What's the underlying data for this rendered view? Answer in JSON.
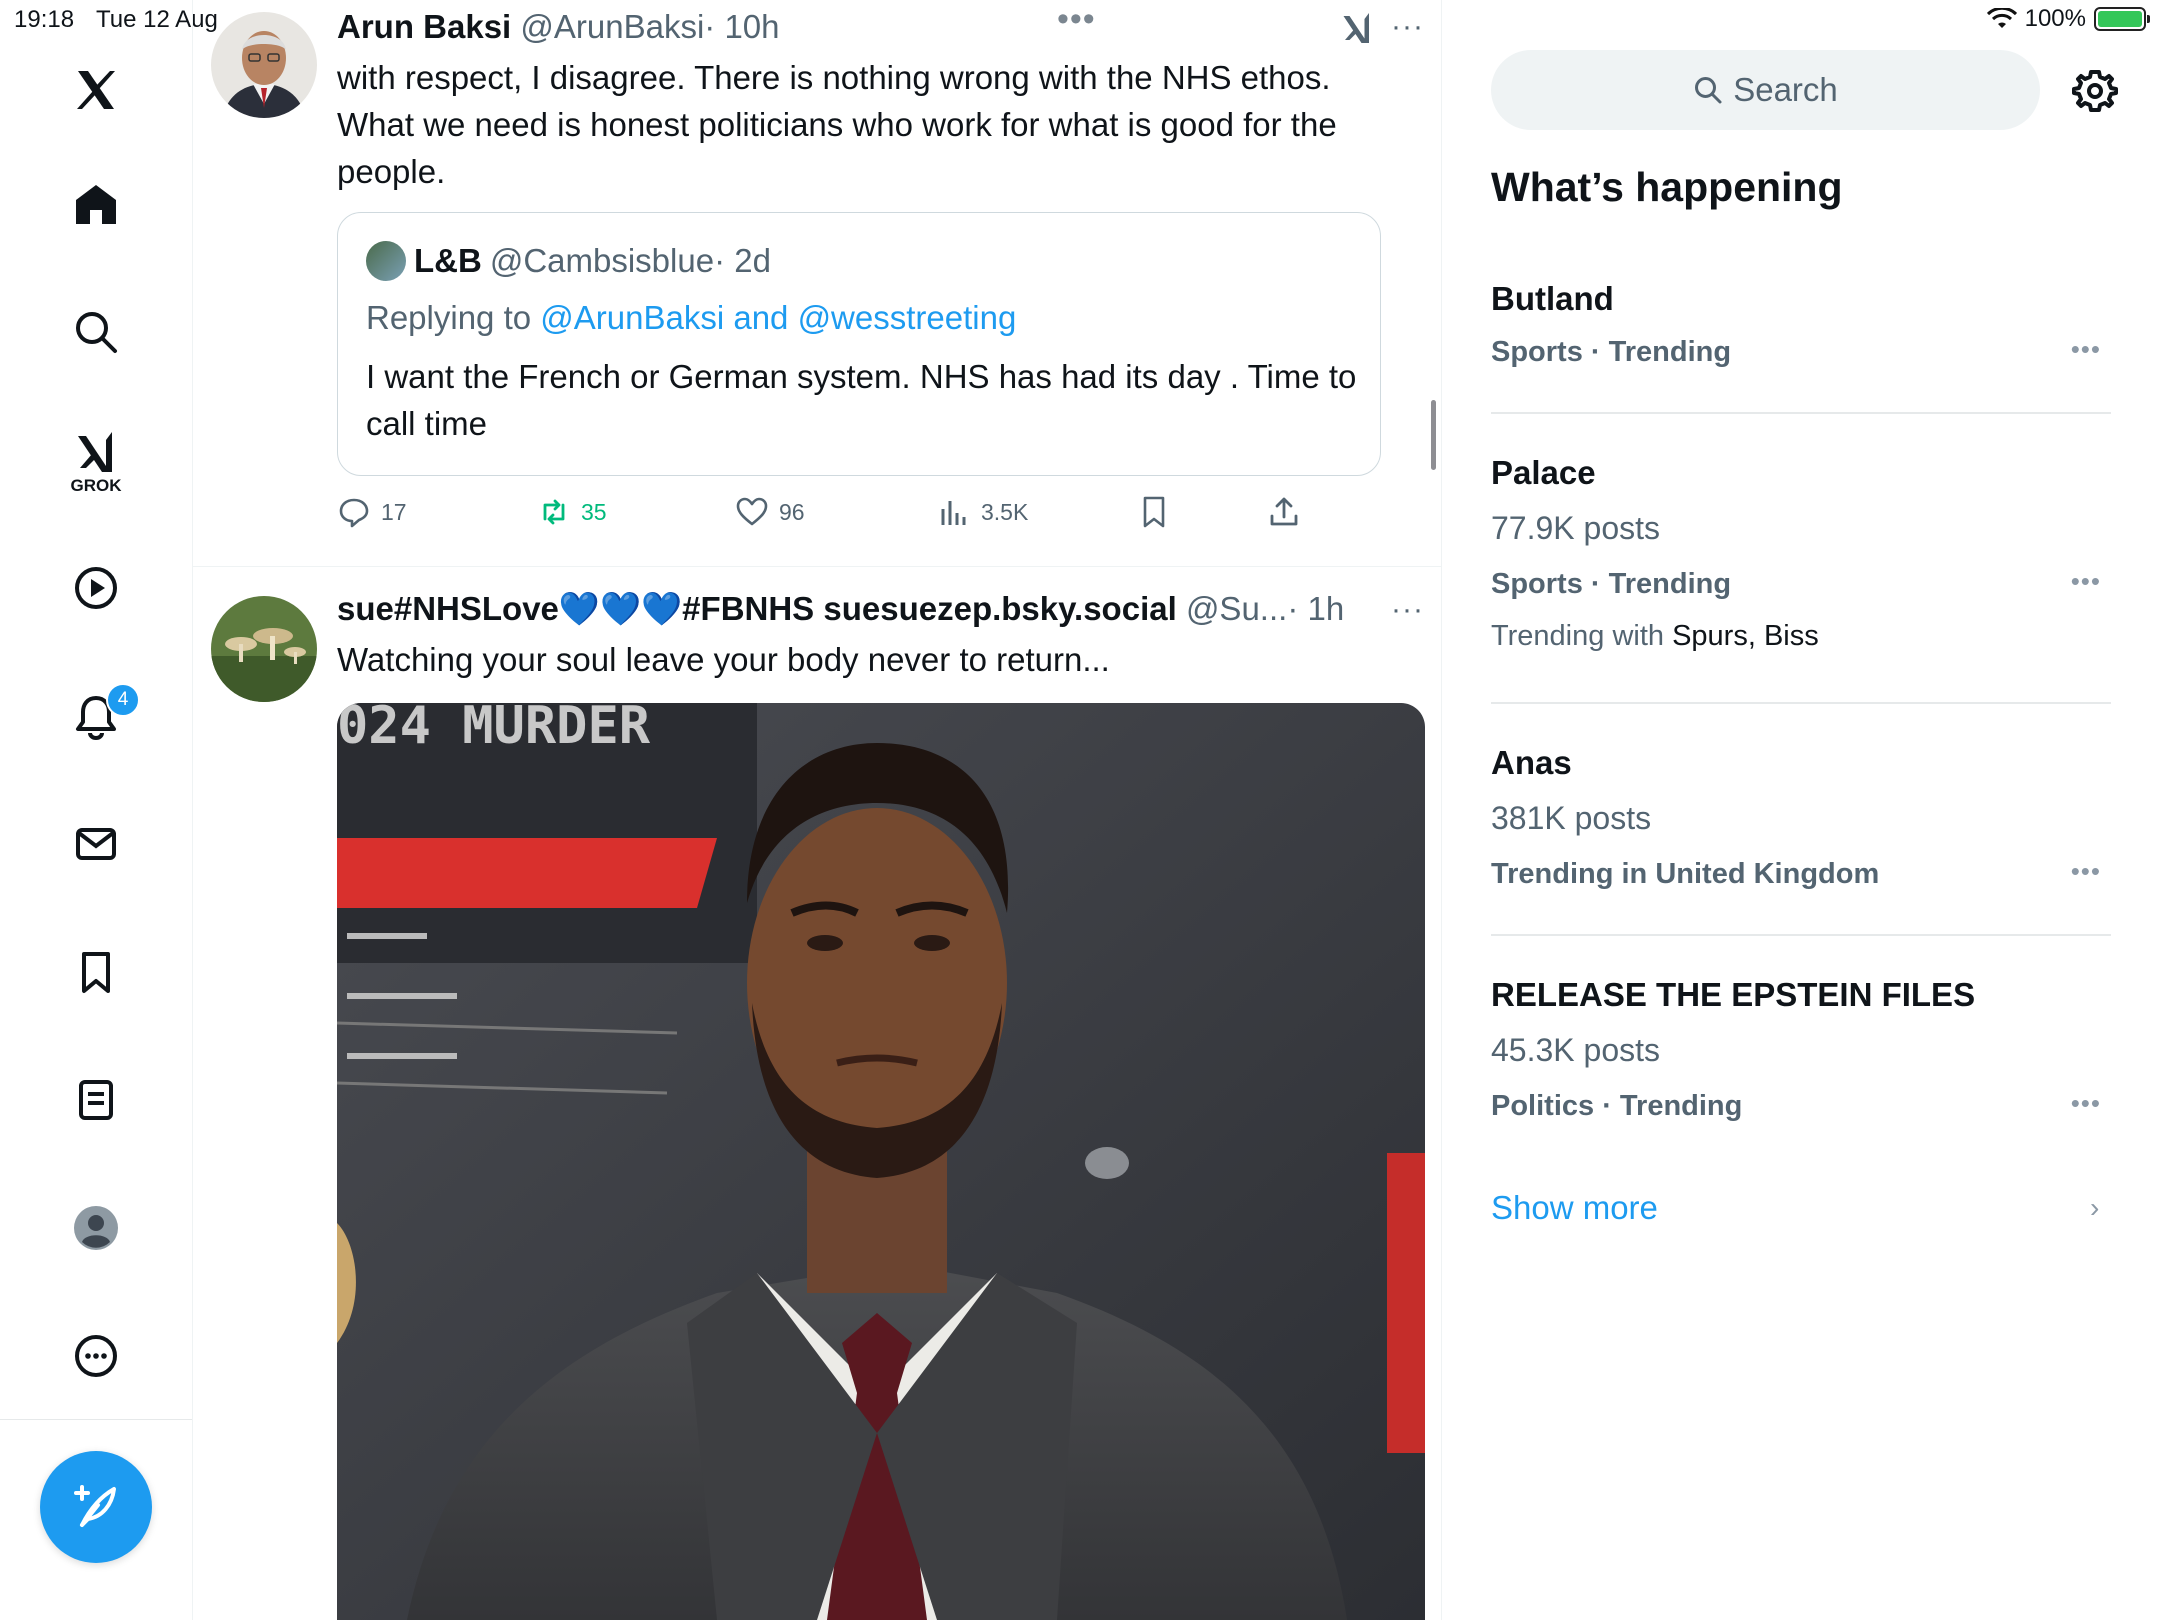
{
  "status_bar": {
    "time": "19:18",
    "date": "Tue 12 Aug",
    "battery": "100%"
  },
  "nav": {
    "grok_label": "GROK",
    "notifications_badge": "4"
  },
  "tweets": [
    {
      "name": "Arun Baksi",
      "handle": "@ArunBaksi",
      "time": "· 10h",
      "text": "with respect, I disagree. There is nothing wrong with the NHS ethos. What we need is honest politicians who work for what is good for the people.",
      "quote": {
        "name": "L&B",
        "handle": "@Cambsisblue",
        "time": "· 2d",
        "replying_prefix": "Replying to ",
        "replying_to": "@ArunBaksi and @wesstreeting",
        "text": "I want the French or German system. NHS has had its day . Time to call time"
      },
      "stats": {
        "replies": "17",
        "retweets": "35",
        "likes": "96",
        "views": "3.5K"
      }
    },
    {
      "name": "sue#NHSLove💙💙💙#FBNHS suesuezep.bsky.social",
      "handle": "@Su...",
      "time": "· 1h",
      "text": "Watching your soul leave your body never to return...",
      "image_overlay_text": "024 MURDER"
    }
  ],
  "sidebar": {
    "search_placeholder": "Search",
    "title": "What’s happening",
    "trends": [
      {
        "name": "Butland",
        "category": "Sports · Trending"
      },
      {
        "name": "Palace",
        "posts": "77.9K posts",
        "category": "Sports · Trending",
        "with_prefix": "Trending with ",
        "with": "Spurs, Biss"
      },
      {
        "name": "Anas",
        "posts": "381K posts",
        "category": "Trending in United Kingdom"
      },
      {
        "name": "RELEASE THE EPSTEIN FILES",
        "posts": "45.3K posts",
        "category": "Politics · Trending"
      }
    ],
    "show_more": "Show more"
  },
  "colors": {
    "accent": "#1d9bf0",
    "retweet": "#00ba7c",
    "text": "#0f1419",
    "muted": "#536471"
  }
}
